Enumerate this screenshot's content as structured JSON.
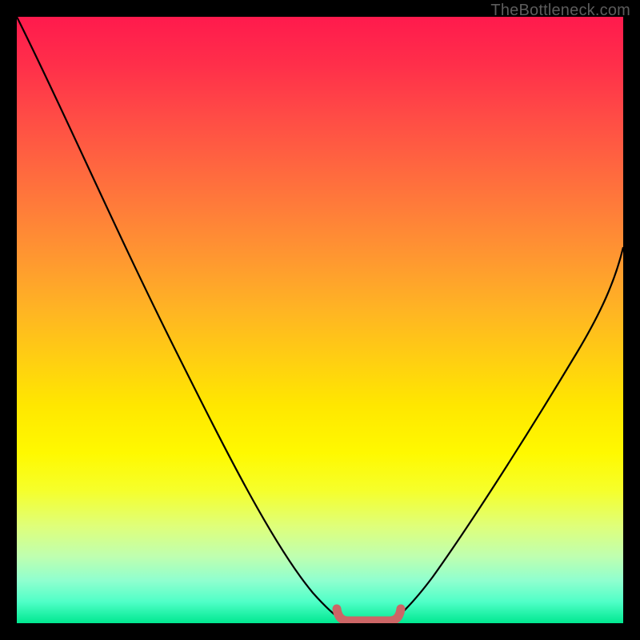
{
  "watermark": "TheBottleneck.com",
  "colors": {
    "frame": "#000000",
    "curve": "#000000",
    "marker": "#cc6666",
    "gradient_top": "#ff1a4d",
    "gradient_bottom": "#00e890"
  },
  "chart_data": {
    "type": "line",
    "title": "",
    "xlabel": "",
    "ylabel": "",
    "xlim": [
      0,
      100
    ],
    "ylim": [
      0,
      100
    ],
    "grid": false,
    "series": [
      {
        "name": "left-curve",
        "x": [
          0,
          5,
          10,
          15,
          20,
          25,
          30,
          35,
          40,
          45,
          48,
          51,
          53,
          54.5
        ],
        "y": [
          100,
          92,
          83,
          74,
          64,
          54,
          44,
          34,
          24,
          14,
          8,
          3,
          1,
          0
        ]
      },
      {
        "name": "right-curve",
        "x": [
          61.5,
          63,
          65,
          68,
          72,
          76,
          80,
          84,
          88,
          92,
          96,
          100
        ],
        "y": [
          0,
          1,
          3,
          7,
          13,
          20,
          27,
          34,
          41,
          48,
          55,
          62
        ]
      },
      {
        "name": "flat-bottom-marker",
        "x": [
          54.5,
          61.5
        ],
        "y": [
          0,
          0
        ]
      }
    ],
    "annotations": [
      {
        "name": "optimal-range-marker",
        "shape": "rounded-bracket",
        "x_start": 53,
        "x_end": 63,
        "y": 0,
        "color": "#cc6666"
      }
    ]
  }
}
